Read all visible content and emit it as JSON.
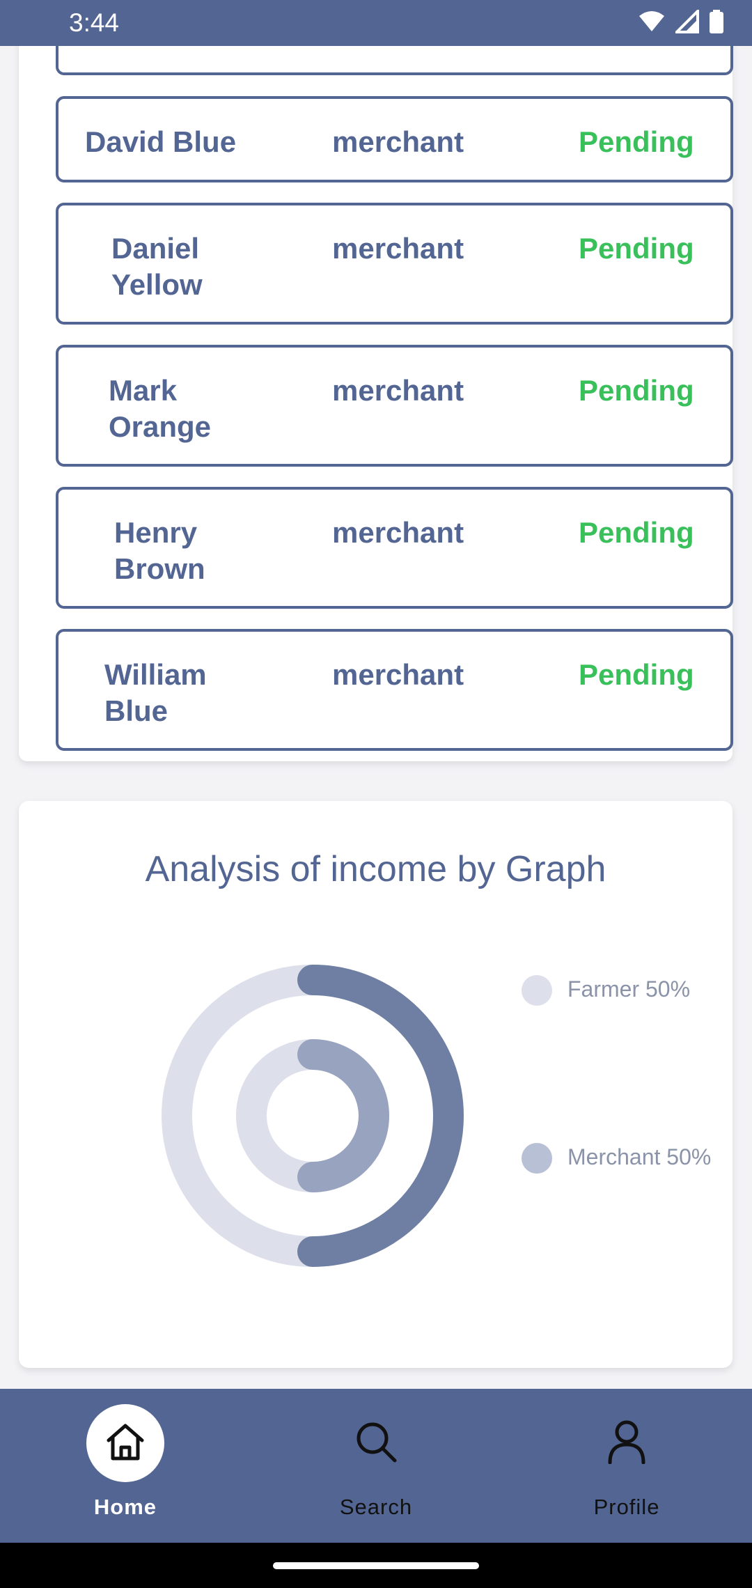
{
  "status_bar": {
    "time": "3:44"
  },
  "user_list": {
    "rows": [
      {
        "name": "",
        "role": "",
        "status": ""
      },
      {
        "name": "David Blue",
        "role": "merchant",
        "status": "Pending"
      },
      {
        "name": "Daniel Yellow",
        "role": "merchant",
        "status": "Pending"
      },
      {
        "name": "Mark Orange",
        "role": "merchant",
        "status": "Pending"
      },
      {
        "name": "Henry Brown",
        "role": "merchant",
        "status": "Pending"
      },
      {
        "name": "William Blue",
        "role": "merchant",
        "status": "Pending"
      }
    ]
  },
  "graph": {
    "title": "Analysis of income by Graph",
    "legend": [
      {
        "label": "Farmer 50%",
        "color": "#dde0ea"
      },
      {
        "label": "Merchant 50%",
        "color": "#b7c0d4"
      }
    ],
    "chart_data": {
      "type": "pie",
      "rings": [
        {
          "name": "Farmer",
          "value": 50,
          "color": "#dde0ea"
        },
        {
          "name": "Merchant",
          "value": 50,
          "color": "#6f7fa3"
        }
      ],
      "inner_ring_value_percent": 50
    }
  },
  "bottom_nav": {
    "items": [
      {
        "label": "Home",
        "icon": "home-icon",
        "active": true
      },
      {
        "label": "Search",
        "icon": "search-icon",
        "active": false
      },
      {
        "label": "Profile",
        "icon": "profile-icon",
        "active": false
      }
    ]
  },
  "colors": {
    "primary": "#536592",
    "status_pending": "#39c05b",
    "background": "#f3f3f6"
  }
}
